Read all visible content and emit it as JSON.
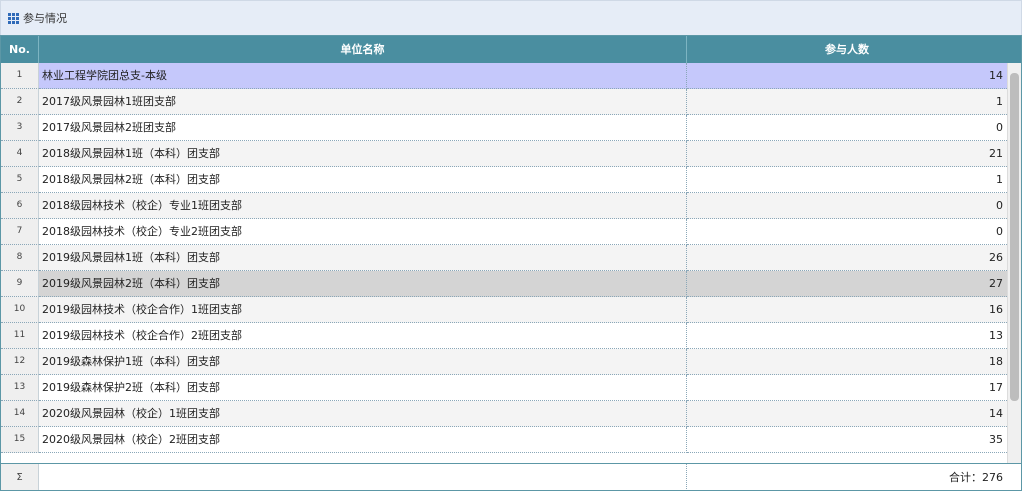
{
  "panel": {
    "title": "参与情况"
  },
  "columns": {
    "no": "No.",
    "name": "单位名称",
    "count": "参与人数"
  },
  "rows": [
    {
      "no": "1",
      "name": "林业工程学院团总支-本级",
      "count": "14",
      "state": "selected"
    },
    {
      "no": "2",
      "name": "2017级风景园林1班团支部",
      "count": "1"
    },
    {
      "no": "3",
      "name": "2017级风景园林2班团支部",
      "count": "0"
    },
    {
      "no": "4",
      "name": "2018级风景园林1班（本科）团支部",
      "count": "21"
    },
    {
      "no": "5",
      "name": "2018级风景园林2班（本科）团支部",
      "count": "1"
    },
    {
      "no": "6",
      "name": "2018级园林技术（校企）专业1班团支部",
      "count": "0"
    },
    {
      "no": "7",
      "name": "2018级园林技术（校企）专业2班团支部",
      "count": "0"
    },
    {
      "no": "8",
      "name": "2019级风景园林1班（本科）团支部",
      "count": "26"
    },
    {
      "no": "9",
      "name": "2019级风景园林2班（本科）团支部",
      "count": "27",
      "state": "hover"
    },
    {
      "no": "10",
      "name": "2019级园林技术（校企合作）1班团支部",
      "count": "16"
    },
    {
      "no": "11",
      "name": "2019级园林技术（校企合作）2班团支部",
      "count": "13"
    },
    {
      "no": "12",
      "name": "2019级森林保护1班（本科）团支部",
      "count": "18"
    },
    {
      "no": "13",
      "name": "2019级森林保护2班（本科）团支部",
      "count": "17"
    },
    {
      "no": "14",
      "name": "2020级风景园林（校企）1班团支部",
      "count": "14"
    },
    {
      "no": "15",
      "name": "2020级风景园林（校企）2班团支部",
      "count": "35"
    }
  ],
  "footer": {
    "sigma": "Σ",
    "total": "合计：276"
  },
  "colors": {
    "header_bg": "#4a8ea0",
    "selected_row": "#c5c8fb",
    "hover_row": "#d4d4d4"
  }
}
